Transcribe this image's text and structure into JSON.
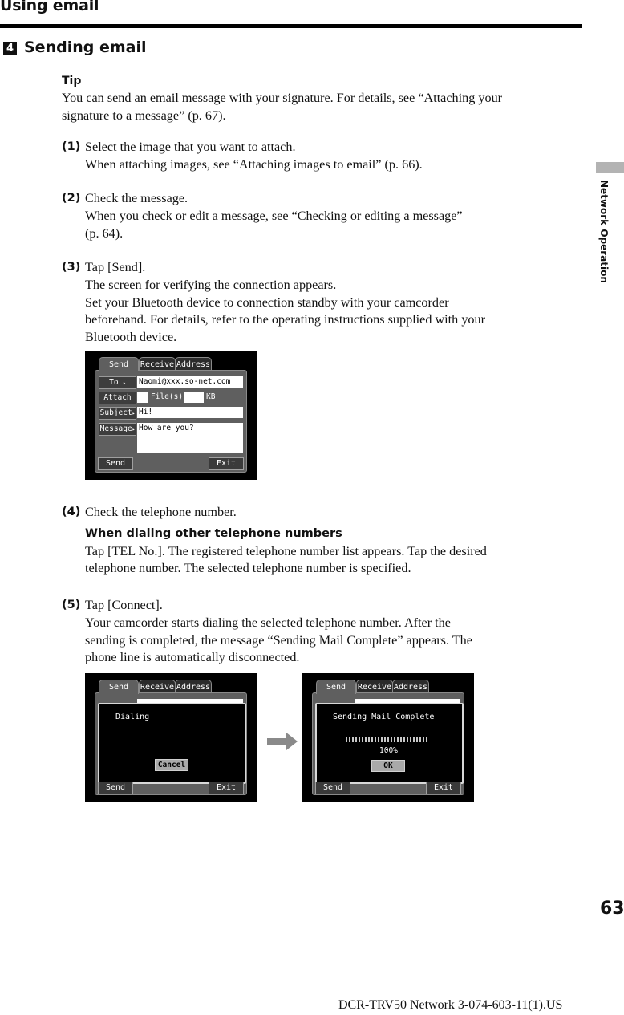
{
  "header": {
    "title": "Using email"
  },
  "section": {
    "number": "4",
    "title": "Sending email"
  },
  "side_tab": {
    "label": "Network Operation"
  },
  "tip": {
    "label": "Tip",
    "lines": [
      "You can send an email message with your signature. For details, see “Attaching your",
      "signature to a message” (p. 67)."
    ]
  },
  "steps": [
    {
      "num": "(1)",
      "lines": [
        "Select the image that you want to attach.",
        "When attaching images, see “Attaching images to email” (p. 66)."
      ]
    },
    {
      "num": "(2)",
      "lines": [
        "Check the message.",
        "When you check or edit a message, see “Checking or editing a message”",
        "(p. 64)."
      ]
    },
    {
      "num": "(3)",
      "lines": [
        "Tap [Send].",
        "The screen for verifying the connection appears.",
        "Set your Bluetooth device to connection standby with your camcorder",
        "beforehand. For details, refer to the operating instructions supplied with your",
        "Bluetooth device."
      ]
    },
    {
      "num": "(4)",
      "lines": [
        "Check the telephone number."
      ],
      "subhead": "When dialing other telephone numbers",
      "sublines": [
        "Tap [TEL No.]. The registered telephone number list appears. Tap the desired",
        "telephone number. The selected telephone number is specified."
      ]
    },
    {
      "num": "(5)",
      "lines": [
        "Tap [Connect].",
        "Your camcorder starts dialing the selected telephone number. After the",
        "sending is completed, the message “Sending Mail Complete” appears.  The",
        "phone line is automatically disconnected."
      ]
    }
  ],
  "screen_compose": {
    "tabs": [
      "Send",
      "Receive",
      "Address"
    ],
    "to_label": "To",
    "to_value": "Naomi@xxx.so-net.com",
    "attach_label": "Attach",
    "files_label": "File(s)",
    "files_value": "",
    "kb_label": "KB",
    "kb_value": "",
    "subject_label": "Subject",
    "subject_value": "Hi!",
    "message_label": "Message",
    "message_value": "How are you?",
    "send_label": "Send",
    "exit_label": "Exit"
  },
  "screen_dialing": {
    "tabs": [
      "Send",
      "Receive",
      "Address"
    ],
    "message": "Dialing",
    "cancel_label": "Cancel",
    "send_label": "Send",
    "exit_label": "Exit"
  },
  "screen_complete": {
    "tabs": [
      "Send",
      "Receive",
      "Address"
    ],
    "message": "Sending Mail Complete",
    "progress_percent": 100,
    "progress_text": "100%",
    "ok_label": "OK",
    "send_label": "Send",
    "exit_label": "Exit"
  },
  "arrow": {
    "icon": "right-arrow-icon"
  },
  "page_number": "63",
  "footer": "DCR-TRV50 Network 3-074-603-11(1).US"
}
